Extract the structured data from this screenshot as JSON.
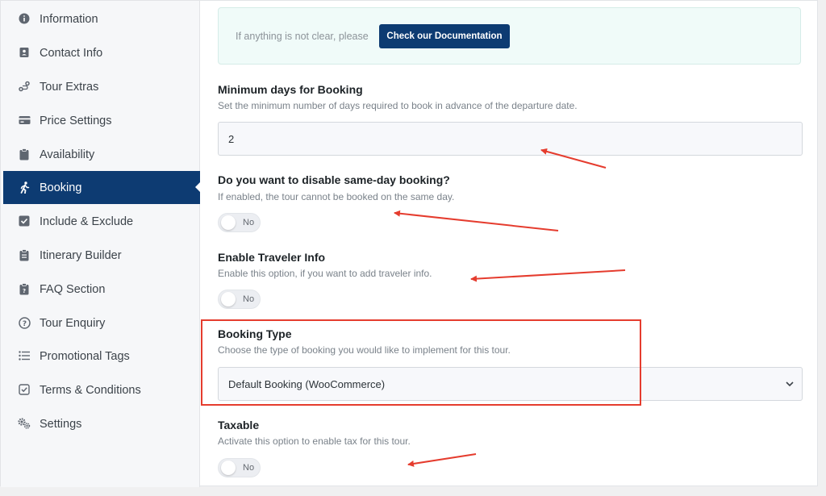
{
  "sidebar": {
    "items": [
      {
        "label": "Information",
        "icon": "info-icon"
      },
      {
        "label": "Contact Info",
        "icon": "contact-icon"
      },
      {
        "label": "Tour Extras",
        "icon": "route-icon"
      },
      {
        "label": "Price Settings",
        "icon": "card-icon"
      },
      {
        "label": "Availability",
        "icon": "clipboard-icon"
      },
      {
        "label": "Booking",
        "icon": "walking-icon"
      },
      {
        "label": "Include & Exclude",
        "icon": "checkbox-icon"
      },
      {
        "label": "Itinerary Builder",
        "icon": "clipboard-list-icon"
      },
      {
        "label": "FAQ Section",
        "icon": "faq-icon"
      },
      {
        "label": "Tour Enquiry",
        "icon": "question-circle-icon"
      },
      {
        "label": "Promotional Tags",
        "icon": "list-icon"
      },
      {
        "label": "Terms & Conditions",
        "icon": "checked-square-icon"
      },
      {
        "label": "Settings",
        "icon": "gears-icon"
      }
    ],
    "active": "Booking"
  },
  "notice": {
    "text": "If anything is not clear, please",
    "button_label": "Check our Documentation"
  },
  "fields": {
    "min_days": {
      "title": "Minimum days for Booking",
      "desc": "Set the minimum number of days required to book in advance of the departure date.",
      "value": "2"
    },
    "same_day": {
      "title": "Do you want to disable same-day booking?",
      "desc": "If enabled, the tour cannot be booked on the same day.",
      "toggle": "No"
    },
    "traveler": {
      "title": "Enable Traveler Info",
      "desc": "Enable this option, if you want to add traveler info.",
      "toggle": "No"
    },
    "booking_type": {
      "title": "Booking Type",
      "desc": "Choose the type of booking you would like to implement for this tour.",
      "selected": "Default Booking (WooCommerce)"
    },
    "taxable": {
      "title": "Taxable",
      "desc": "Activate this option to enable tax for this tour.",
      "toggle": "No"
    }
  },
  "colors": {
    "accent": "#0d3b72",
    "annotation": "#e53c2e"
  }
}
